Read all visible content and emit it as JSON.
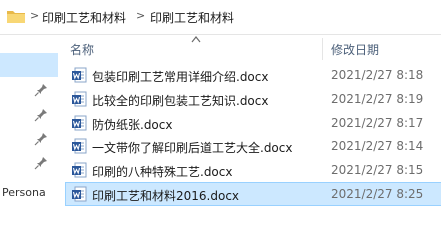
{
  "address_bar": {
    "sep1": ">",
    "crumb1": "印刷工艺和材料",
    "sep2": ">",
    "crumb2": "印刷工艺和材料"
  },
  "navigation": {
    "quick_access_label": "Persona",
    "expand_arrow": ">"
  },
  "columns": {
    "name": "名称",
    "date_modified": "修改日期"
  },
  "files": [
    {
      "name": "包装印刷工艺常用详细介绍.docx",
      "date": "2021/2/27 8:18"
    },
    {
      "name": "比较全的印刷包装工艺知识.docx",
      "date": "2021/2/27 8:19"
    },
    {
      "name": "防伪纸张.docx",
      "date": "2021/2/27 8:17"
    },
    {
      "name": "一文带你了解印刷后道工艺大全.docx",
      "date": "2021/2/27 8:14"
    },
    {
      "name": "印刷的八种特殊工艺.docx",
      "date": "2021/2/27 8:15"
    },
    {
      "name": "印刷工艺和材料2016.docx",
      "date": "2021/2/27 8:25"
    }
  ],
  "selected_index": 5,
  "colors": {
    "selection": "#cce8ff",
    "selection_border": "#99d1ff",
    "header_text": "#4c607a",
    "word_blue": "#2b579a",
    "folder_yellow": "#f8d775"
  },
  "icons": {
    "folder": "folder-icon",
    "pin": "pin-icon",
    "file": "word-document-icon"
  }
}
